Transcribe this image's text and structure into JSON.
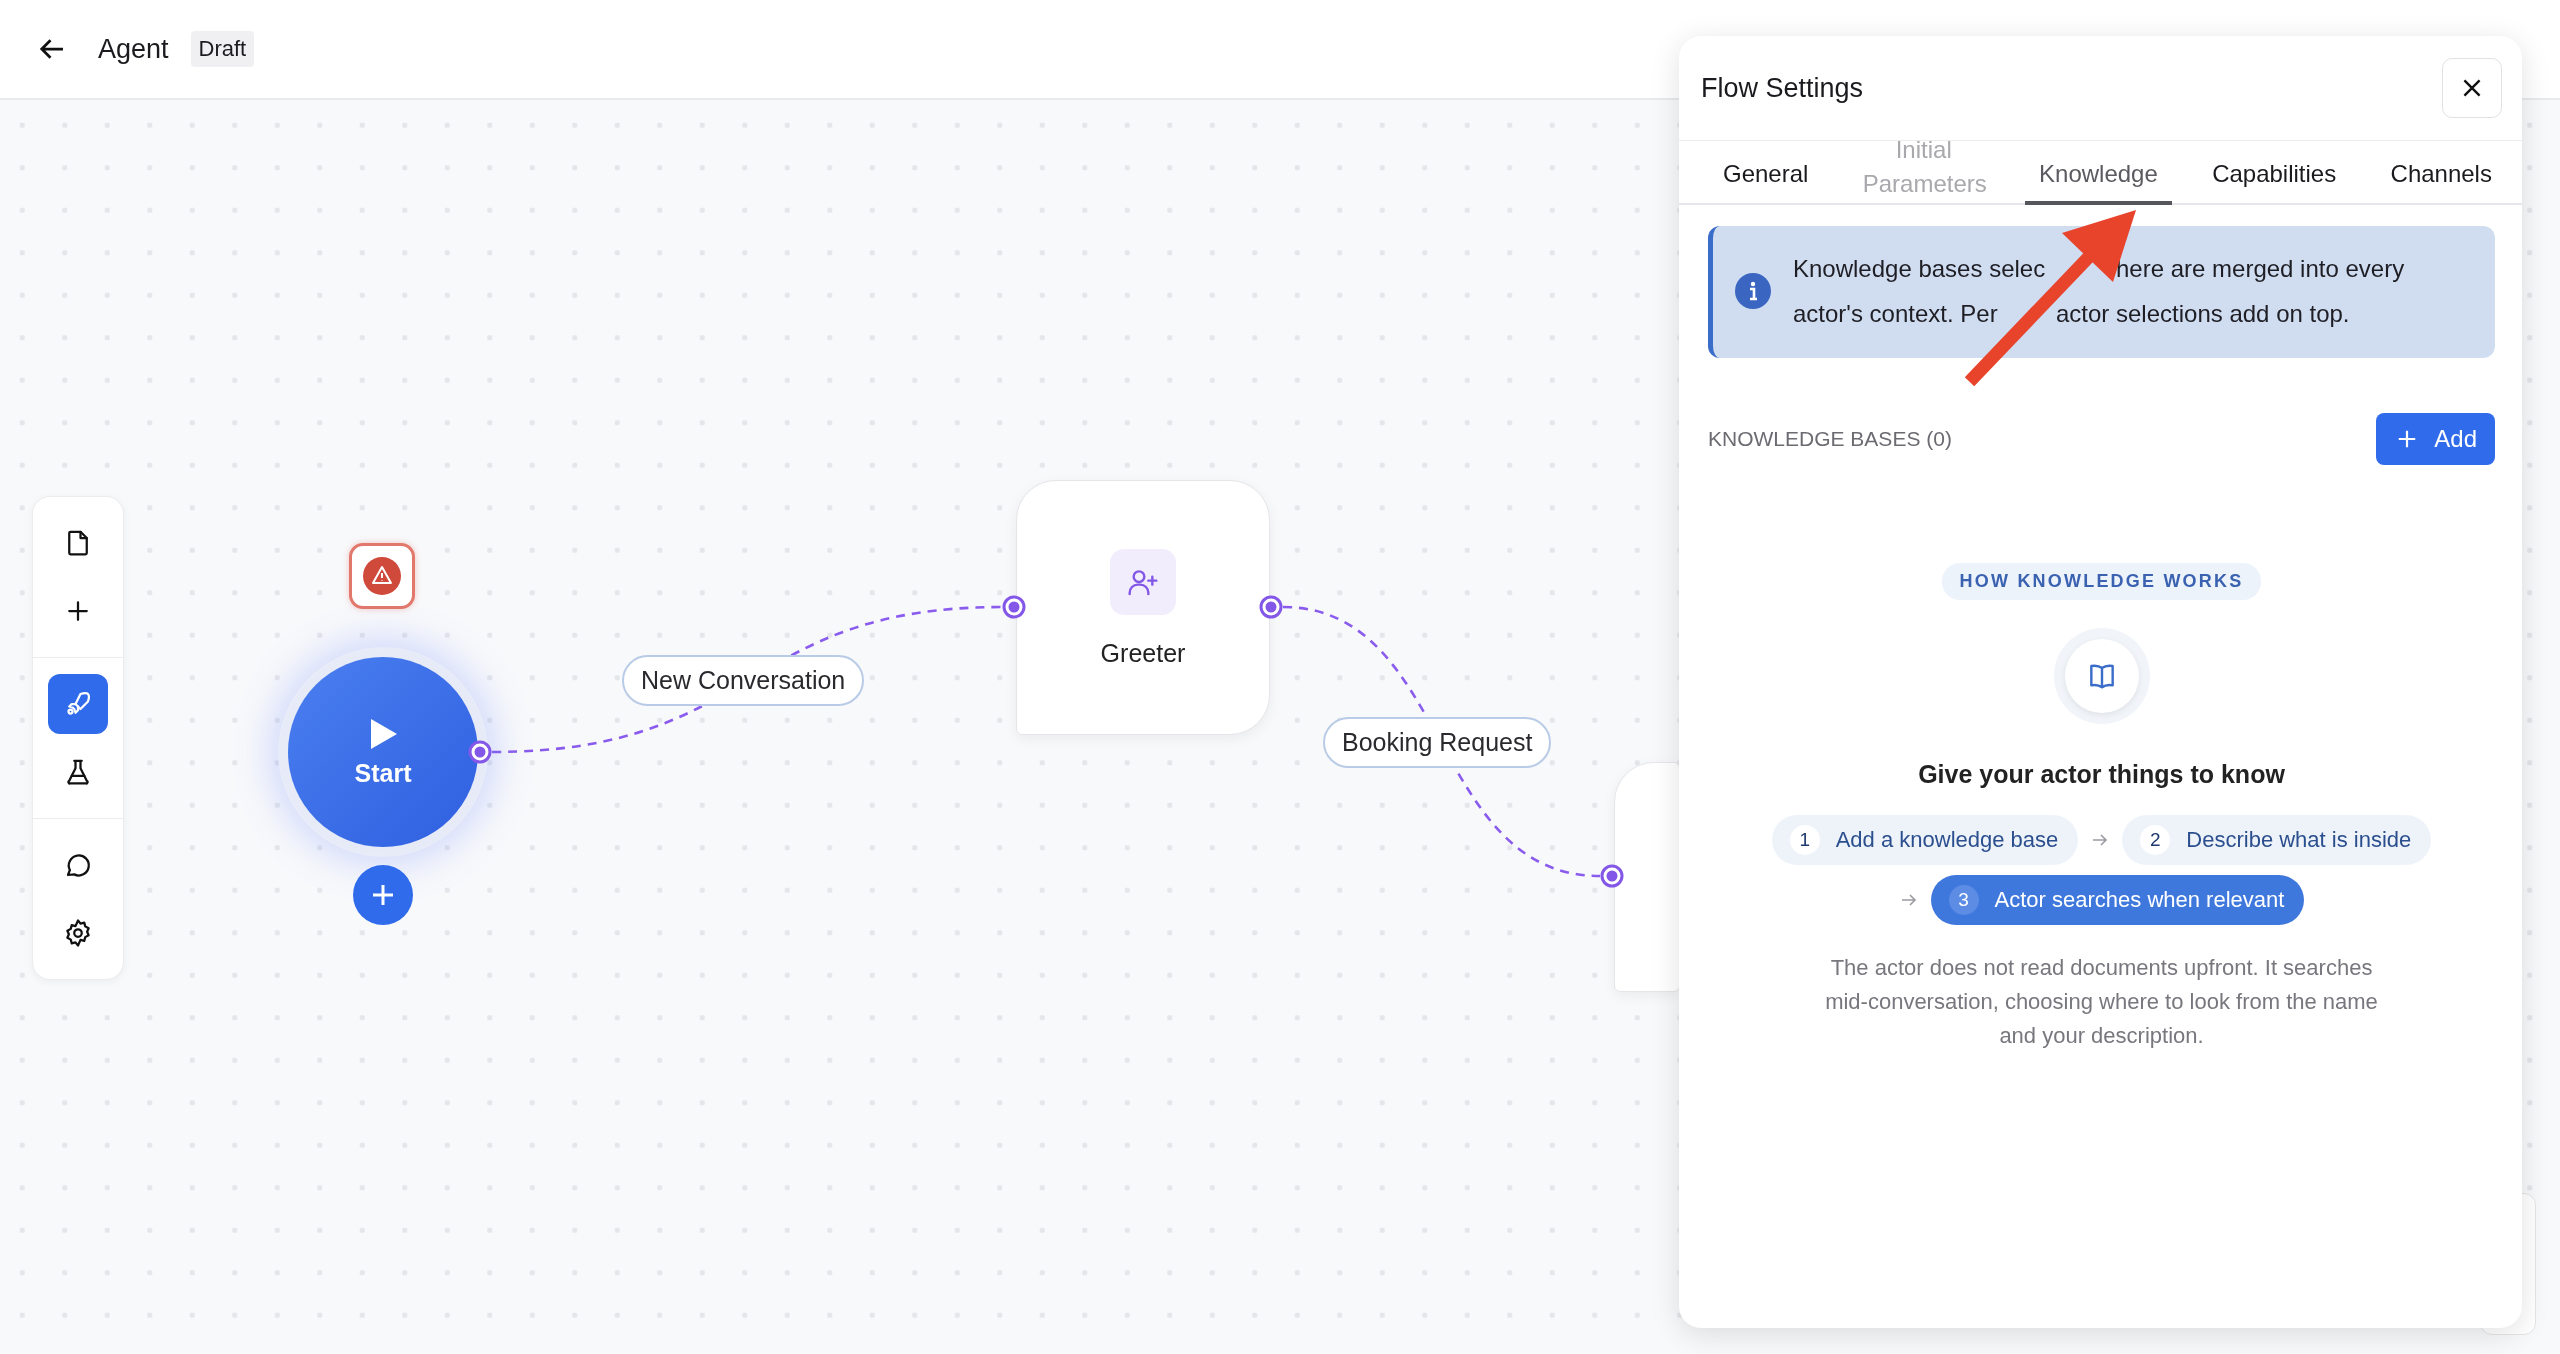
{
  "header": {
    "title": "Agent",
    "badge": "Draft"
  },
  "toolbar": {
    "groups": [
      {
        "items": [
          {
            "kind": "file",
            "selected": false
          },
          {
            "kind": "add",
            "selected": false
          }
        ]
      },
      {
        "items": [
          {
            "kind": "rocket",
            "selected": true
          },
          {
            "kind": "flask",
            "selected": false
          }
        ]
      },
      {
        "items": [
          {
            "kind": "chat",
            "selected": false
          },
          {
            "kind": "settings",
            "selected": false
          }
        ]
      }
    ]
  },
  "canvas": {
    "start": {
      "label": "Start"
    },
    "nodes": [
      {
        "label": "Greeter"
      }
    ],
    "edges": [
      {
        "label": "New Conversation"
      },
      {
        "label": "Booking Request"
      }
    ]
  },
  "panel": {
    "title": "Flow Settings",
    "tabs": [
      {
        "label": "General",
        "selected": false,
        "disabled": false
      },
      {
        "label": "Initial Parameters",
        "selected": false,
        "disabled": true
      },
      {
        "label": "Knowledge",
        "selected": true,
        "disabled": false
      },
      {
        "label": "Capabilities",
        "selected": false,
        "disabled": false
      },
      {
        "label": "Channels",
        "selected": false,
        "disabled": false
      }
    ],
    "info": {
      "lines": [
        [
          "Knowledge bases selec",
          "here are merged into every"
        ],
        [
          "actor's context. Per",
          "actor selections add on top."
        ]
      ]
    },
    "section": {
      "title": "KNOWLEDGE BASES (0)",
      "add_button": "Add"
    },
    "guide": {
      "badge": "HOW KNOWLEDGE WORKS",
      "heading": "Give your actor things to know",
      "steps": [
        {
          "number": "1",
          "label": "Add a knowledge base",
          "selected": false
        },
        {
          "number": "2",
          "label": "Describe what is inside",
          "selected": false
        },
        {
          "number": "3",
          "label": "Actor searches when relevant",
          "selected": true
        }
      ],
      "note": "The actor does not read documents upfront. It searches mid-conversation, choosing where to look from the name and your description."
    }
  }
}
